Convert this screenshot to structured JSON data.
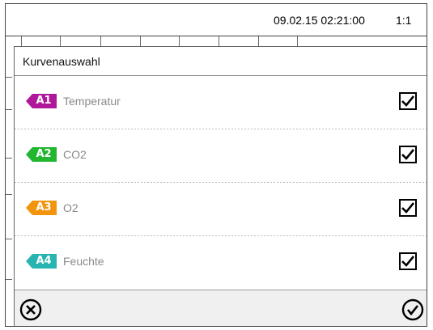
{
  "header": {
    "datetime": "09.02.15 02:21:00",
    "ratio": "1:1"
  },
  "dialog": {
    "title": "Kurvenauswahl",
    "items": [
      {
        "tag": "A1",
        "label": "Temperatur",
        "color": "#b0179a",
        "checked": true
      },
      {
        "tag": "A2",
        "label": "CO2",
        "color": "#21b530",
        "checked": true
      },
      {
        "tag": "A3",
        "label": "O2",
        "color": "#f2950d",
        "checked": true
      },
      {
        "tag": "A4",
        "label": "Feuchte",
        "color": "#28b4b0",
        "checked": true
      }
    ],
    "footer": {
      "cancel_icon": "circle-x-icon",
      "confirm_icon": "circle-check-icon"
    }
  }
}
